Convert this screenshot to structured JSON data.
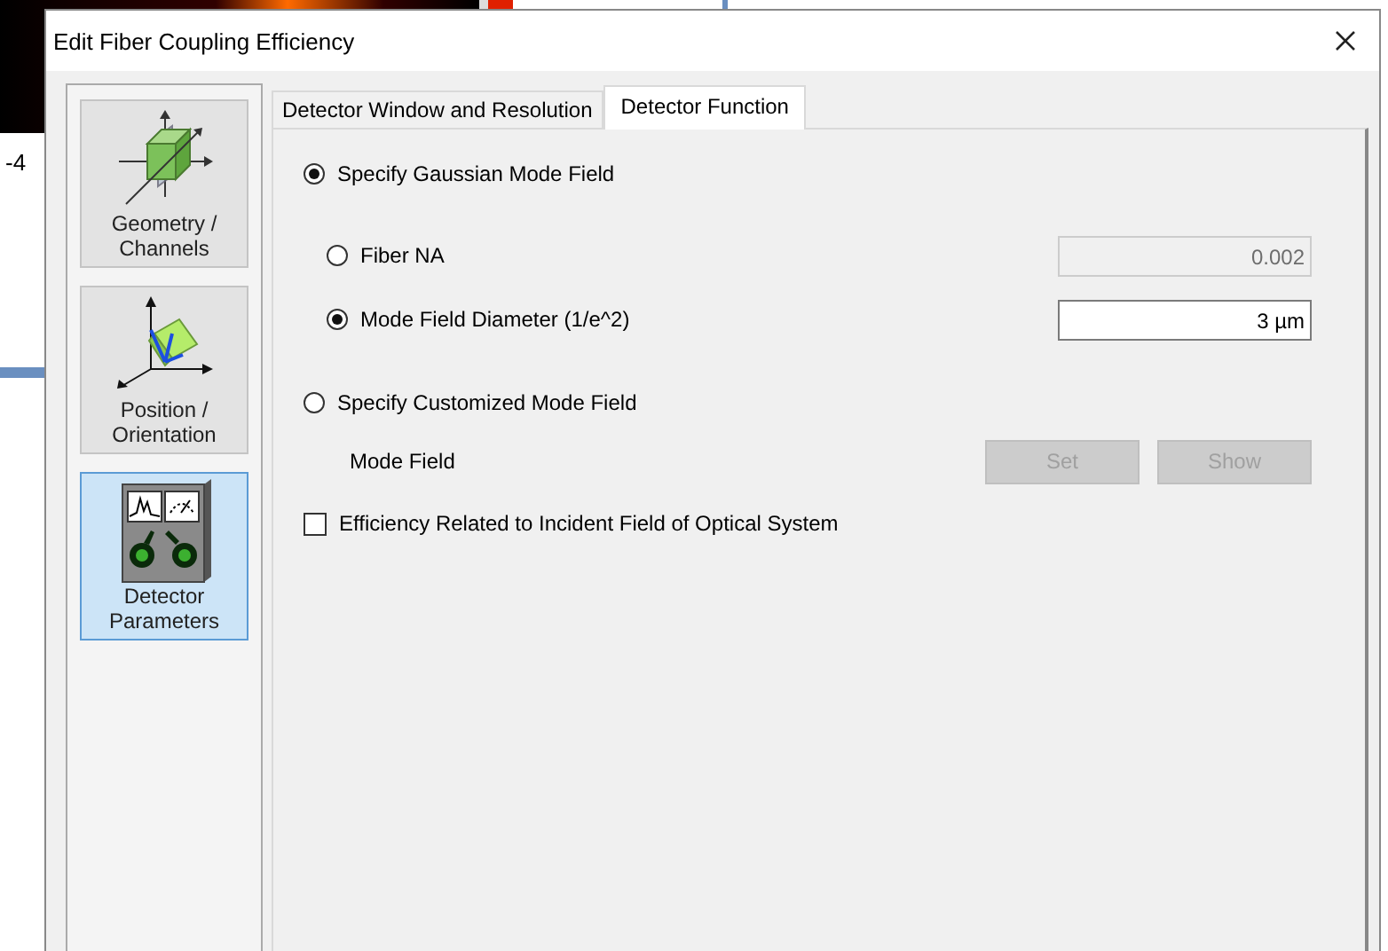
{
  "background_window": {
    "axis_label": "-4"
  },
  "window": {
    "title": "Edit Fiber Coupling Efficiency"
  },
  "sidebar": {
    "items": [
      {
        "label": "Geometry / Channels",
        "kind": "geometry",
        "selected": false
      },
      {
        "label": "Position / Orientation",
        "kind": "position",
        "selected": false
      },
      {
        "label": "Detector Parameters",
        "kind": "detector",
        "selected": true
      }
    ]
  },
  "tabs": [
    {
      "label": "Detector Window and Resolution",
      "selected": false
    },
    {
      "label": "Detector Function",
      "selected": true
    }
  ],
  "gaussian": {
    "label": "Specify Gaussian Mode Field",
    "selected": true,
    "options": [
      {
        "label": "Fiber NA",
        "selected": false,
        "value": "0.002",
        "disabled": true
      },
      {
        "label": "Mode Field Diameter (1/e^2)",
        "selected": true,
        "value": "3 µm",
        "disabled": false
      }
    ]
  },
  "customized": {
    "label": "Specify Customized Mode Field",
    "selected": false,
    "mode_field_label": "Mode Field",
    "buttons": [
      {
        "label": "Set",
        "disabled": true
      },
      {
        "label": "Show",
        "disabled": true
      }
    ]
  },
  "efficiency_checkbox": {
    "label": "Efficiency Related to Incident Field of Optical System",
    "checked": false
  }
}
